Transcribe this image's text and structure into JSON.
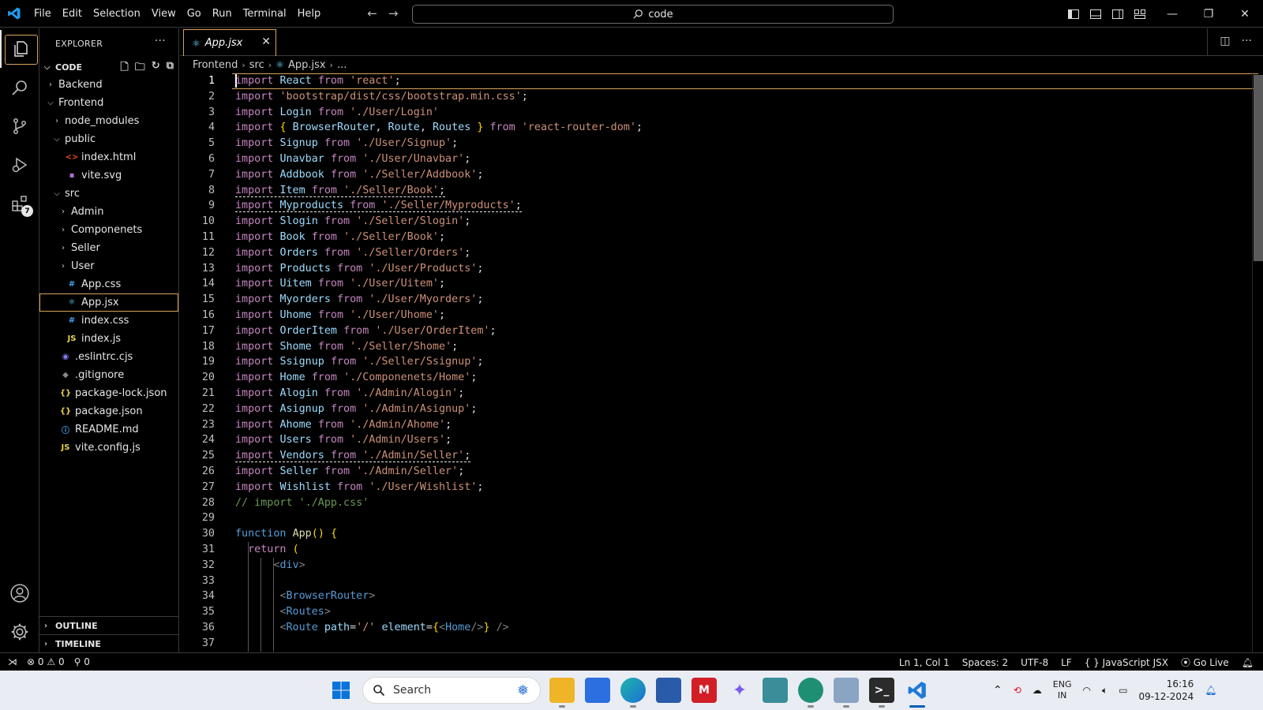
{
  "menu": [
    "File",
    "Edit",
    "Selection",
    "View",
    "Go",
    "Run",
    "Terminal",
    "Help"
  ],
  "command_center": {
    "text": "code"
  },
  "activity_bar": {
    "extensions_badge": "7"
  },
  "explorer": {
    "title": "EXPLORER",
    "root": "CODE",
    "tree": [
      {
        "label": "Backend",
        "kind": "folder",
        "open": false,
        "depth": 0
      },
      {
        "label": "Frontend",
        "kind": "folder",
        "open": true,
        "depth": 0
      },
      {
        "label": "node_modules",
        "kind": "folder",
        "open": false,
        "depth": 1
      },
      {
        "label": "public",
        "kind": "folder",
        "open": true,
        "depth": 1
      },
      {
        "label": "index.html",
        "kind": "html",
        "depth": 2
      },
      {
        "label": "vite.svg",
        "kind": "svg",
        "depth": 2
      },
      {
        "label": "src",
        "kind": "folder",
        "open": true,
        "depth": 1
      },
      {
        "label": "Admin",
        "kind": "folder",
        "open": false,
        "depth": 2
      },
      {
        "label": "Componenets",
        "kind": "folder",
        "open": false,
        "depth": 2
      },
      {
        "label": "Seller",
        "kind": "folder",
        "open": false,
        "depth": 2
      },
      {
        "label": "User",
        "kind": "folder",
        "open": false,
        "depth": 2
      },
      {
        "label": "App.css",
        "kind": "css",
        "depth": 2
      },
      {
        "label": "App.jsx",
        "kind": "jsx",
        "depth": 2,
        "selected": true
      },
      {
        "label": "index.css",
        "kind": "css",
        "depth": 2
      },
      {
        "label": "index.js",
        "kind": "js",
        "depth": 2
      },
      {
        "label": ".eslintrc.cjs",
        "kind": "eslint",
        "depth": 1
      },
      {
        "label": ".gitignore",
        "kind": "git",
        "depth": 1
      },
      {
        "label": "package-lock.json",
        "kind": "json",
        "depth": 1
      },
      {
        "label": "package.json",
        "kind": "json",
        "depth": 1
      },
      {
        "label": "README.md",
        "kind": "info",
        "depth": 1
      },
      {
        "label": "vite.config.js",
        "kind": "js",
        "depth": 1
      }
    ],
    "outline": "OUTLINE",
    "timeline": "TIMELINE"
  },
  "tab": {
    "label": "App.jsx"
  },
  "breadcrumb": [
    "Frontend",
    "src",
    "App.jsx",
    "..."
  ],
  "code": [
    "import React from 'react';",
    "import 'bootstrap/dist/css/bootstrap.min.css';",
    "import Login from './User/Login'",
    "import { BrowserRouter, Route, Routes } from 'react-router-dom';",
    "import Signup from './User/Signup';",
    "import Unavbar from './User/Unavbar';",
    "import Addbook from './Seller/Addbook';",
    "import Item from './Seller/Book';",
    "import Myproducts from './Seller/Myproducts';",
    "import Slogin from './Seller/Slogin';",
    "import Book from './Seller/Book';",
    "import Orders from './Seller/Orders';",
    "import Products from './User/Products';",
    "import Uitem from './User/Uitem';",
    "import Myorders from './User/Myorders';",
    "import Uhome from './User/Uhome';",
    "import OrderItem from './User/OrderItem';",
    "import Shome from './Seller/Shome';",
    "import Ssignup from './Seller/Ssignup';",
    "import Home from './Componenets/Home';",
    "import Alogin from './Admin/Alogin';",
    "import Asignup from './Admin/Asignup';",
    "import Ahome from './Admin/Ahome';",
    "import Users from './Admin/Users';",
    "import Vendors from './Admin/Seller';",
    "import Seller from './Admin/Seller';",
    "import Wishlist from './User/Wishlist';",
    "// import './App.css'",
    "",
    "function App() {",
    "  return (",
    "      <div>",
    "",
    "       <BrowserRouter>",
    "       <Routes>",
    "       <Route path='/' element={<Home/>} />",
    ""
  ],
  "status": {
    "errors": "0",
    "warnings": "0",
    "ports": "0",
    "position": "Ln 1, Col 1",
    "spaces": "Spaces: 2",
    "encoding": "UTF-8",
    "eol": "LF",
    "language": "JavaScript JSX",
    "golive": "Go Live"
  },
  "taskbar": {
    "search_placeholder": "Search",
    "lang_top": "ENG",
    "lang_bottom": "IN",
    "time": "16:16",
    "date": "09-12-2024"
  },
  "colors": {
    "accent": "#d9a25a",
    "keyword": "#c586c0",
    "string": "#ce9178",
    "variable": "#9cdcfe",
    "function": "#dcdcaa",
    "comment": "#6a9955",
    "jsx_tag": "#569cd6"
  }
}
